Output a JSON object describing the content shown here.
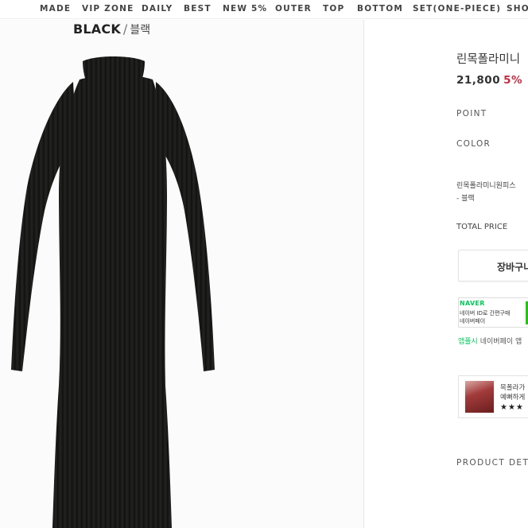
{
  "nav": {
    "items": [
      "MADE",
      "VIP ZONE",
      "DAILY",
      "BEST",
      "NEW 5%",
      "OUTER",
      "TOP",
      "BOTTOM",
      "SET(ONE-PIECE)",
      "SHO"
    ]
  },
  "image": {
    "color_en": "BLACK",
    "slash": "/",
    "color_kr": "블랙"
  },
  "product": {
    "title": "린목폴라미니",
    "price": "21,800",
    "discount": "5%",
    "point_label": "POINT",
    "color_label": "COLOR",
    "selected_name": "린목폴라미니원피스",
    "selected_color": "- 블랙",
    "total_label": "TOTAL PRICE",
    "cart_button": "장바구니"
  },
  "naver": {
    "logo": "NAVER",
    "line1": "네이버 ID로 간편구매",
    "line2": "네이버페이",
    "note_green": "앱플시",
    "note_rest": " 네이버페이 앱"
  },
  "review": {
    "line1": "목폴라가",
    "line2": "예뻐하게",
    "stars": "★★★"
  },
  "detail": {
    "label": "PRODUCT DET"
  },
  "colors": {
    "discount": "#c22b42",
    "naver_green": "#1ec800",
    "dress": "#1b1c1a"
  }
}
